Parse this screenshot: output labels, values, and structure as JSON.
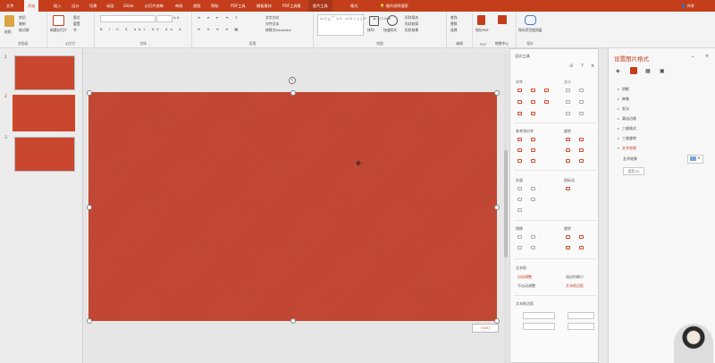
{
  "tabs": {
    "file": "文件",
    "home": "开始",
    "insert": "插入",
    "design": "设计",
    "transitions": "切换",
    "animations": "动画",
    "islide": "iSlide",
    "slideshow": "幻灯片放映",
    "review": "审阅",
    "view": "视图",
    "help": "帮助",
    "pdf": "PDF工具",
    "template": "模板素材",
    "pdf2": "PDF工具集",
    "ctx_picture": "图片工具",
    "format": "格式"
  },
  "search": {
    "label": "操作说明搜索"
  },
  "share": {
    "label": "共享"
  },
  "ribbon": {
    "paste": "粘贴",
    "cut": "剪切",
    "copy": "复制",
    "format_painter": "格式刷",
    "clipboard": "剪贴板",
    "new_slide": "新建幻灯片",
    "layout": "版式",
    "reset": "重置",
    "section": "节",
    "slides": "幻灯片",
    "font_group": "字体",
    "paragraph": "段落",
    "text_direction": "文字方向",
    "align_text": "对齐文本",
    "smartart": "转换为SmartArt",
    "drawing": "绘图",
    "arrange": "排列",
    "quick_styles": "快速样式",
    "shape_fill": "形状填充",
    "shape_outline": "形状轮廓",
    "shape_effects": "形状效果",
    "find": "查找",
    "replace": "替换",
    "select": "选择",
    "editing": "编辑",
    "save_pdf": "保存PDF",
    "pdf_group": "PDF",
    "convert": "转换中心",
    "save_cloud": "保存到百度网盘",
    "save_group": "保存"
  },
  "thumbnails": [
    {
      "num": "1"
    },
    {
      "num": "2"
    },
    {
      "num": "3"
    }
  ],
  "canvas": {
    "ctrl_label": "(Ctrl)"
  },
  "design_tools": {
    "title": "设计工具",
    "align": "对齐",
    "size": "大小",
    "distribute": "参考线对齐",
    "rotate": "旋转",
    "arrow": "矢量",
    "crop": "图标化",
    "mirror": "镜像",
    "shadow": "旋转",
    "text_box": "文本框",
    "text_wrap": "自动调整",
    "text_fit": "溢出时缩小",
    "text_none": "不自动调整",
    "text_shape": "文本框边距",
    "text_spacing": "文本框边距"
  },
  "format_pane": {
    "title": "设置图片格式",
    "items": [
      "阴影",
      "映像",
      "发光",
      "柔化边缘",
      "三维格式",
      "三维旋转",
      "艺术效果"
    ],
    "sub_label": "艺术效果",
    "reset": "重置(R)"
  },
  "colors": {
    "brand": "#c43e1c",
    "slide": "#c44430"
  }
}
